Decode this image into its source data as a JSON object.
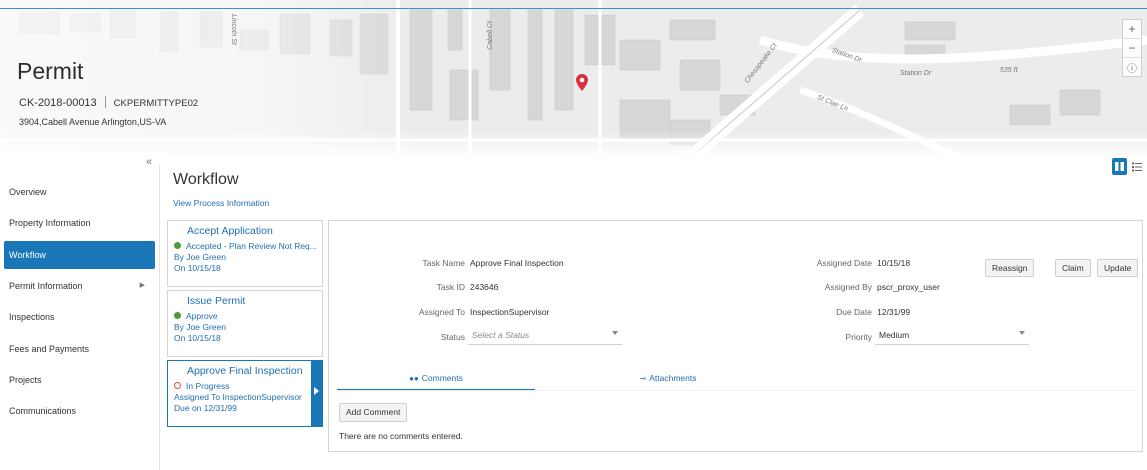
{
  "header": {
    "title": "Permit",
    "permit_number": "CK-2018-00013",
    "permit_type": "CKPERMITTYPE02",
    "address": "3904,Cabell Avenue Arlington,US-VA"
  },
  "map": {
    "street_labels": [
      "Station Dr",
      "Station Dr",
      "St Clair Ln",
      "Cabell Ct",
      "Chesapeake Ct",
      "Lincoln St"
    ],
    "scale_label": "535 ft",
    "zoom_in": "+",
    "zoom_out": "−",
    "info": "ⓘ",
    "pin_color": "#d8333d"
  },
  "nav": {
    "collapse_icon": "«",
    "items": [
      {
        "label": "Overview"
      },
      {
        "label": "Property Information"
      },
      {
        "label": "Workflow",
        "active": true
      },
      {
        "label": "Permit Information",
        "has_submenu": true
      },
      {
        "label": "Inspections"
      },
      {
        "label": "Fees and Payments"
      },
      {
        "label": "Projects"
      },
      {
        "label": "Communications"
      }
    ]
  },
  "workflow": {
    "title": "Workflow",
    "link": "View Process Information",
    "steps": [
      {
        "title": "Accept Application",
        "status": "Accepted - Plan Review Not Req...",
        "by": "By Joe Green",
        "on": "On 10/15/18",
        "state": "done"
      },
      {
        "title": "Issue Permit",
        "status": "Approve",
        "by": "By Joe Green",
        "on": "On 10/15/18",
        "state": "done"
      },
      {
        "title": "Approve Final Inspection",
        "status": "In Progress",
        "by": "Assigned To InspectionSupervisor",
        "on": "Due on 12/31/99",
        "state": "in-progress"
      }
    ]
  },
  "detail": {
    "buttons": {
      "reassign": "Reassign",
      "claim": "Claim",
      "update": "Update"
    },
    "task_name_label": "Task Name",
    "task_name": "Approve Final Inspection",
    "task_id_label": "Task ID",
    "task_id": "243646",
    "assigned_to_label": "Assigned To",
    "assigned_to": "InspectionSupervisor",
    "status_label": "Status",
    "status_placeholder": "Select a Status",
    "assigned_date_label": "Assigned Date",
    "assigned_date": "10/15/18",
    "assigned_by_label": "Assigned By",
    "assigned_by": "pscr_proxy_user",
    "due_date_label": "Due Date",
    "due_date": "12/31/99",
    "priority_label": "Priority",
    "priority": "Medium",
    "tabs": {
      "comments": "Comments",
      "attachments": "Attachments"
    },
    "add_comment": "Add Comment",
    "empty_comments": "There are no comments entered."
  },
  "colors": {
    "accent": "#1976b7",
    "link": "#1f6fb2",
    "done": "#4b9b3a",
    "in_progress": "#d9523a"
  }
}
